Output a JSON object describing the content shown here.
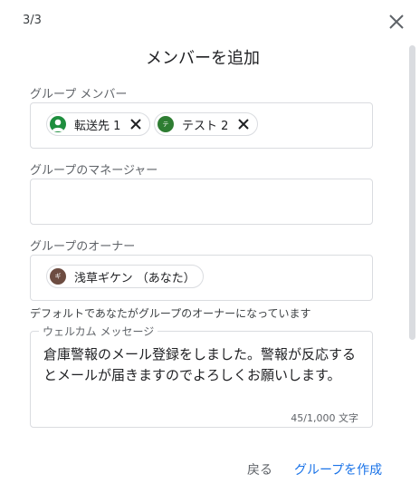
{
  "step": "3/3",
  "title": "メンバーを追加",
  "members": {
    "label": "グループ メンバー",
    "chips": [
      {
        "name": "転送先 1",
        "avatar": "person",
        "color": "#1e8e3e"
      },
      {
        "name": "テスト 2",
        "avatar": "テ",
        "color": "#2e7d32"
      }
    ]
  },
  "managers": {
    "label": "グループのマネージャー"
  },
  "owners": {
    "label": "グループのオーナー",
    "chips": [
      {
        "name": "浅草ギケン （あなた）",
        "avatar": "ギ",
        "color": "#6d4c41"
      }
    ],
    "hint": "デフォルトであなたがグループのオーナーになっています"
  },
  "welcome": {
    "label": "ウェルカム メッセージ",
    "text": "倉庫警報のメール登録をしました。警報が反応するとメールが届きますのでよろしくお願いします。",
    "counter": "45/1,000 文字"
  },
  "buttons": {
    "back": "戻る",
    "create": "グループを作成"
  }
}
